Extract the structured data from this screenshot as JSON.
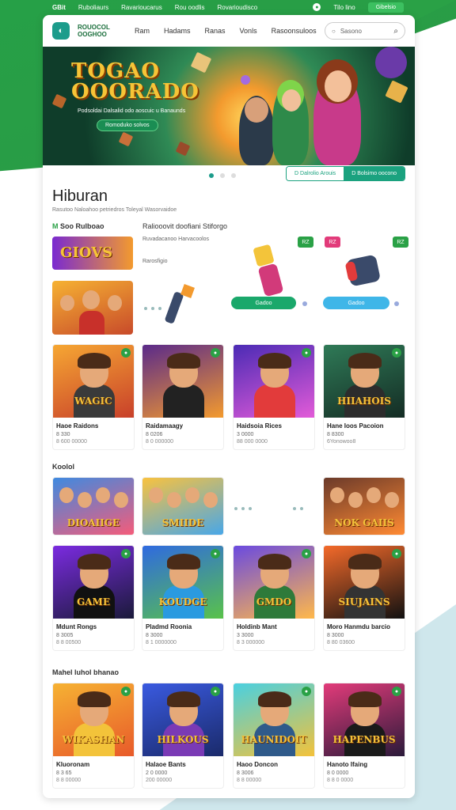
{
  "topbar": {
    "brand": "GBit",
    "links": [
      "Ruboliaurs",
      "Ravarioucarus",
      "Rou oodlis",
      "Rovarioudisco"
    ],
    "icon_label": "Tilo lino",
    "button": "Gibelsio"
  },
  "header": {
    "logo_line1": "ROUOCOL",
    "logo_line2": "OOGHOO",
    "nav": [
      "Ram",
      "Hadams",
      "Ranas",
      "Vonls",
      "Rasoonsuloos"
    ],
    "search_placeholder": "Sasono"
  },
  "hero": {
    "title_line1": "TOGAO",
    "title_line2": "OOORADO",
    "subtitle": "Podsoldai Dalsalid odo aoscuic u Banaunds",
    "cta": "Romoduko solvos"
  },
  "hero_tabs": [
    "D Dalrolio Arouis",
    "D Bolsimo oocono"
  ],
  "section": {
    "title": "Hiburan",
    "subtitle": "Rasutoo Naloahoo petriedros Toleyal Wasorvaidoe"
  },
  "feature": {
    "left_label_prefix": "M",
    "left_label": "Soo Rulboao",
    "mid_title": "Raliooovit doofiani Stiforgo",
    "mid_sub": "Ruvadacanoo Harvacoolos",
    "mid_sub2": "Rarosfigio",
    "card_title": "GIOVS",
    "btn1": "Gadoo",
    "btn2": "Gadoo",
    "tags": [
      "RZ",
      "RZ",
      "RZ"
    ]
  },
  "grid1": [
    {
      "name": "Haoe Raidons",
      "m1": "8 330",
      "m2": "8 600 00000",
      "word": "WAGIC",
      "bg": "linear-gradient(160deg,#f6a733,#c8402a)",
      "body": "#3a3a3a"
    },
    {
      "name": "Raidamaagy",
      "m1": "8 0206",
      "m2": "8 0 000000",
      "word": "",
      "bg": "linear-gradient(160deg,#5a2a8a,#f39a2e)",
      "body": "#222"
    },
    {
      "name": "Haidsoia Rices",
      "m1": "3 0000",
      "m2": "88 000 0000",
      "word": "",
      "bg": "linear-gradient(160deg,#4b2bb5,#e25bd8)",
      "body": "#e23b3b"
    },
    {
      "name": "Hane Ioos Pacoion",
      "m1": "8 8300",
      "m2": "6Yonowoo8",
      "word": "HIIAHOIS",
      "bg": "linear-gradient(160deg,#2f7a57,#142c24)",
      "body": "#2c2c2c"
    }
  ],
  "section2": "Koolol",
  "row2": [
    {
      "word": "DIOAIIGE",
      "bg": "linear-gradient(160deg,#3f8ae0,#f45c7a)"
    },
    {
      "word": "SMIIDE",
      "bg": "linear-gradient(160deg,#f9c23f,#48a7e8)"
    },
    {
      "word": "NOK GAIIS",
      "bg": "linear-gradient(160deg,#6b3a2a,#ff8a33)"
    }
  ],
  "grid2": [
    {
      "name": "Mdunt Rongs",
      "m1": "8 3005",
      "m2": "8 8 00500",
      "word": "GAME",
      "bg": "linear-gradient(160deg,#7b2be0,#1a1a3a)",
      "body": "#111"
    },
    {
      "name": "Pladmd Roonia",
      "m1": "8 3000",
      "m2": "8 1 0000000",
      "word": "KOUDGE",
      "bg": "linear-gradient(160deg,#2f6ae0,#59c24a)",
      "body": "#2a9ae0"
    },
    {
      "name": "Holdinb Mant",
      "m1": "3 3000",
      "m2": "8 3 000000",
      "word": "GMDO",
      "bg": "linear-gradient(160deg,#6a4ae0,#ffb84a)",
      "body": "#2e7a3a"
    },
    {
      "name": "Moro Hanmdu barcio",
      "m1": "8 3000",
      "m2": "8 80 03600",
      "word": "SIUJAINS",
      "bg": "linear-gradient(160deg,#f46a2a,#111)",
      "body": "#333"
    }
  ],
  "section3": "Mahel luhol bhanao",
  "grid3": [
    {
      "name": "Kluoronam",
      "m1": "8 3 65",
      "m2": "8 8 00000",
      "word": "WIKASHAN",
      "bg": "linear-gradient(160deg,#f6b233,#e85a2a)",
      "body": "#f3c33a"
    },
    {
      "name": "Halaoe Bants",
      "m1": "2 0 0000",
      "m2": "200 00000",
      "word": "HILKOUS",
      "bg": "linear-gradient(160deg,#3a5ae0,#1a2a6a)",
      "body": "#7a3ab5"
    },
    {
      "name": "Haoo Doncon",
      "m1": "8 3006",
      "m2": "8 8 00000",
      "word": "HAUNIDOIT",
      "bg": "linear-gradient(160deg,#4ad0e0,#f3c23a)",
      "body": "#2f5a8a"
    },
    {
      "name": "Hanoto Ifaing",
      "m1": "8 0 0000",
      "m2": "8 8 0 0000",
      "word": "HAPENBUS",
      "bg": "linear-gradient(160deg,#e23b7a,#2a1a3a)",
      "body": "#1a1a1a"
    }
  ],
  "colors": {
    "brand_green": "#2aa146",
    "teal": "#1c9c8b"
  }
}
